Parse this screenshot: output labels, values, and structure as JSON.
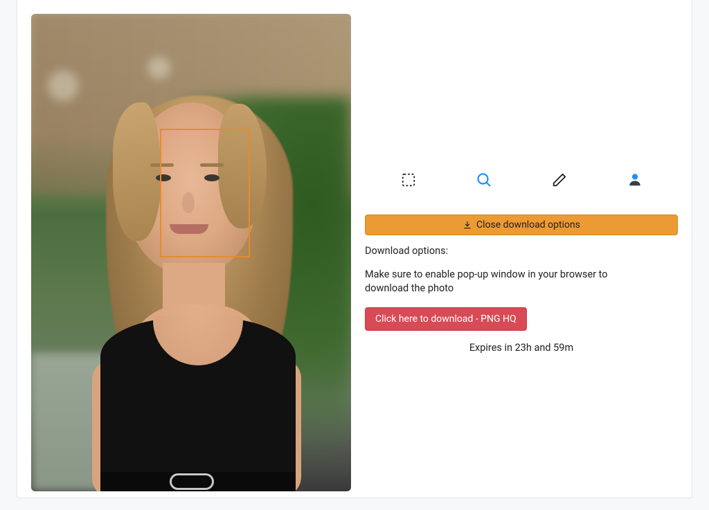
{
  "toolbar": {
    "crop_icon": "crop-selection-icon",
    "zoom_icon": "magnifier-icon",
    "edit_icon": "pencil-icon",
    "person_icon": "person-icon"
  },
  "close_bar": {
    "icon": "download-icon",
    "label": "Close download options"
  },
  "download": {
    "section_label": "Download options:",
    "help_text": "Make sure to enable pop-up window in your browser to download the photo",
    "button_label": "Click here to download - PNG HQ",
    "expiry_text": "Expires in 23h and 59m"
  },
  "photo": {
    "detection_box": true
  }
}
